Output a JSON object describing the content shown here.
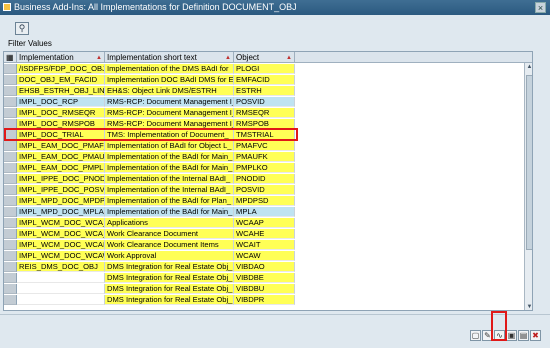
{
  "window": {
    "title": "Business Add-Ins: All Implementations for Definition DOCUMENT_OBJ"
  },
  "filter_label": "Filter Values",
  "columns": [
    "Implementation",
    "Implementation short text",
    "Object"
  ],
  "rows": [
    {
      "impl": "/ISDFPS/FDP_DOC_OBJ",
      "text": "Implementation of the DMS BAdI for",
      "obj": "PLOGI",
      "color": "yellow"
    },
    {
      "impl": "DOC_OBJ_EM_FACID",
      "text": "Implementation DOC BAdI DMS for E_",
      "obj": "EMFACID",
      "color": "yellow"
    },
    {
      "impl": "EHSB_ESTRH_OBJ_LINK",
      "text": "EH&S: Object Link DMS/ESTRH",
      "obj": "ESTRH",
      "color": "yellow"
    },
    {
      "impl": "IMPL_DOC_RCP",
      "text": "RMS-RCP: Document Management I_",
      "obj": "POSVID",
      "color": "blue"
    },
    {
      "impl": "IMPL_DOC_RMSEQR",
      "text": "RMS-RCP: Document Management I_",
      "obj": "RMSEQR",
      "color": "yellow"
    },
    {
      "impl": "IMPL_DOC_RMSPOB",
      "text": "RMS-RCP: Document Management I_",
      "obj": "RMSPOB",
      "color": "yellow"
    },
    {
      "impl": "IMPL_DOC_TRIAL",
      "text": "TMS: Implementation of Document_",
      "obj": "TMSTRIAL",
      "color": "yellow"
    },
    {
      "impl": "IMPL_EAM_DOC_PMAF_",
      "text": "Implementation of BAdI for Object L_",
      "obj": "PMAFVC",
      "color": "yellow"
    },
    {
      "impl": "IMPL_EAM_DOC_PMAU_",
      "text": "Implementation of the BAdI for Main_",
      "obj": "PMAUFK",
      "color": "yellow"
    },
    {
      "impl": "IMPL_EAM_DOC_PMPLK_",
      "text": "Implementation of the BAdI for Main_",
      "obj": "PMPLKO",
      "color": "yellow"
    },
    {
      "impl": "IMPL_IPPE_DOC_PNOD_",
      "text": "Implementation of the Internal BAdI_",
      "obj": "PNODID",
      "color": "yellow"
    },
    {
      "impl": "IMPL_IPPE_DOC_POSVID",
      "text": "Implementation of the Internal BAdI_",
      "obj": "POSVID",
      "color": "yellow"
    },
    {
      "impl": "IMPL_MPD_DOC_MPDP_",
      "text": "Implementation of the BAdI for Plan_",
      "obj": "MPDPSD",
      "color": "yellow"
    },
    {
      "impl": "IMPL_MPD_DOC_MPLA",
      "text": "Implementation of the BAdI for Main_",
      "obj": "MPLA",
      "color": "blue"
    },
    {
      "impl": "IMPL_WCM_DOC_WCA_",
      "text": "Applications",
      "obj": "WCAAP",
      "color": "yellow"
    },
    {
      "impl": "IMPL_WCM_DOC_WCA_",
      "text": "Work Clearance Document",
      "obj": "WCAHE",
      "color": "yellow"
    },
    {
      "impl": "IMPL_WCM_DOC_WCAIT",
      "text": "Work Clearance Document Items",
      "obj": "WCAIT",
      "color": "yellow"
    },
    {
      "impl": "IMPL_WCM_DOC_WCAW",
      "text": "Work Approval",
      "obj": "WCAW",
      "color": "yellow"
    },
    {
      "impl": "REIS_DMS_DOC_OBJ",
      "text": "DMS Integration for Real Estate Obj_",
      "obj": "VIBDAO",
      "color": "yellow"
    },
    {
      "impl": "",
      "text": "DMS Integration for Real Estate Obj_",
      "obj": "VIBDBE",
      "color": "yellow"
    },
    {
      "impl": "",
      "text": "DMS Integration for Real Estate Obj_",
      "obj": "VIBDBU",
      "color": "yellow"
    },
    {
      "impl": "",
      "text": "DMS Integration for Real Estate Obj_",
      "obj": "VIBDPR",
      "color": "yellow"
    }
  ],
  "icons": {
    "toolbar": "filter-icon",
    "bottom": [
      "new-doc-icon",
      "edit-icon",
      "display-icon",
      "delete-icon",
      "list-icon",
      "cancel-icon"
    ]
  },
  "colors": {
    "highlight_yellow": "#ffff56",
    "highlight_blue": "#bfe3f1",
    "annotation_red": "#e01818"
  }
}
